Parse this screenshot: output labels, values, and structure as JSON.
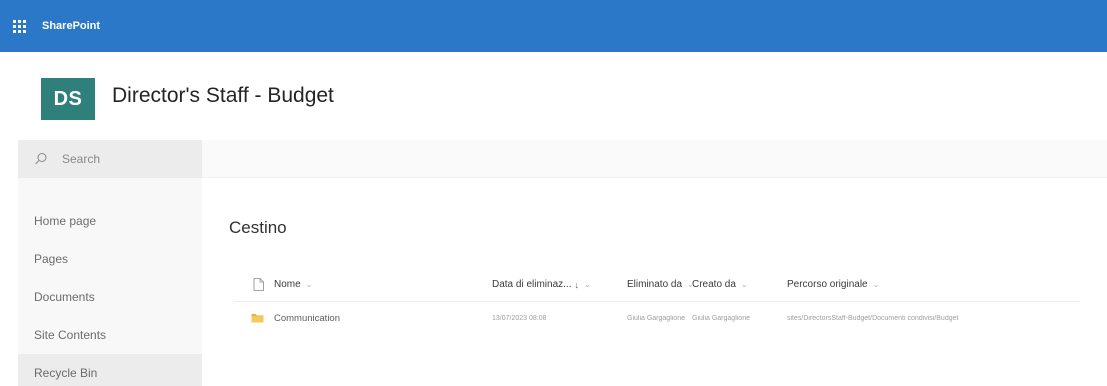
{
  "suite_bar": {
    "app_name": "SharePoint",
    "color": "#2b78c9"
  },
  "site": {
    "logo_initials": "DS",
    "logo_color": "#2f7f7b",
    "title": "Director's Staff - Budget"
  },
  "search": {
    "placeholder": "Search"
  },
  "nav": {
    "items": [
      {
        "label": "Home page"
      },
      {
        "label": "Pages"
      },
      {
        "label": "Documents"
      },
      {
        "label": "Site Contents"
      },
      {
        "label": "Recycle Bin",
        "active": true
      }
    ]
  },
  "page": {
    "title": "Cestino"
  },
  "list": {
    "columns": {
      "name": "Nome",
      "deleted_date": "Data di eliminaz...",
      "deleted_by": "Eliminato da",
      "created_by": "Creato da",
      "original_path": "Percorso originale"
    },
    "rows": [
      {
        "icon": "folder-icon",
        "name": "Communication",
        "deleted_date": "13/07/2023 08:08",
        "deleted_by": "Giulia Gargaglione",
        "created_by": "Giulia Gargaglione",
        "original_path": "sites/DirectorsStaff-Budget/Documenti condivisi/Budget"
      }
    ]
  }
}
